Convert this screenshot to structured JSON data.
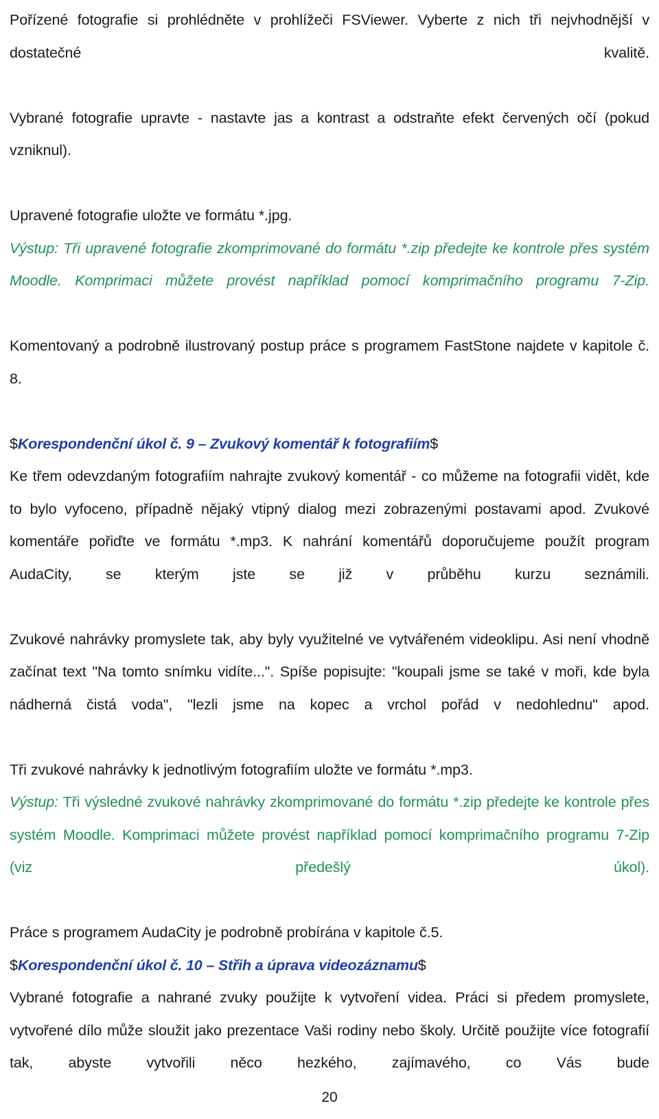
{
  "document": {
    "page_number": "20",
    "colors": {
      "body_text": "#1a1a1a",
      "output_green": "#1f9156",
      "heading_blue": "#1f3fa8"
    }
  },
  "blocks": {
    "para_review_photos": "Pořízené fotografie si prohlédněte v prohlížeči FSViewer. Vyberte z nich tři nejvhodnější v dostatečné kvalitě.",
    "para_edit_photos": "Vybrané fotografie upravte - nastavte jas a kontrast a odstraňte efekt červených očí (pokud vzniknul).",
    "para_save_format": "Upravené fotografie uložte ve formátu *.jpg.",
    "output_photos": "Výstup: Tři upravené fotografie zkomprimované do formátu *.zip předejte ke kontrole přes systém Moodle. Komprimaci můžete provést například pomocí komprimačního programu 7-Zip.",
    "para_faststone": "Komentovaný a podrobně ilustrovaný postup práce s programem FastStone najdete v kapitole č. 8.",
    "heading_task_9": {
      "prefix": "$",
      "text": "Korespondenční úkol č. 9 – Zvukový komentář k fotografiím",
      "suffix": "$"
    },
    "para_audio_comment": "Ke třem odevzdaným fotografiím nahrajte zvukový komentář - co můžeme na fotografii vidět, kde to bylo vyfoceno, případně nějaký vtipný dialog mezi zobrazenými postavami apod. Zvukové komentáře pořiďte ve formátu *.mp3. K nahrání komentářů doporučujeme použít program AudaCity, se kterým jste se již v průběhu kurzu seznámili.",
    "para_recordings_advice": "Zvukové nahrávky promyslete tak, aby byly využitelné ve vytvářeném videoklipu. Asi není vhodně začínat text \"Na tomto snímku vidíte...\". Spíše popisujte: \"koupali jsme se také v moři, kde byla nádherná čistá voda\", \"lezli jsme na kopec a vrchol pořád v nedohlednu\" apod.",
    "para_three_recordings": "Tři zvukové nahrávky k jednotlivým fotografiím uložte ve formátu *.mp3.",
    "output_audio": {
      "label": "Výstup:",
      "text": " Tři výsledné zvukové nahrávky zkomprimované do formátu *.zip předejte ke kontrole přes systém Moodle. Komprimaci můžete provést například pomocí komprimačního programu 7-Zip (viz předešlý úkol)."
    },
    "para_audacity_chapter": "Práce s programem AudaCity je podrobně probírána v kapitole č.5.",
    "heading_task_10": {
      "prefix": "$",
      "text": "Korespondenční úkol č. 10 – Střih a úprava videozáznamu",
      "suffix": "$"
    },
    "para_video_intro": "Vybrané fotografie a nahrané zvuky použijte k vytvoření videa. Práci si předem promyslete, vytvořené dílo může sloužit jako prezentace Vaši rodiny nebo školy. Určitě použijte více fotografií tak, abyste vytvořili něco hezkého, zajímavého, co Vás bude"
  }
}
